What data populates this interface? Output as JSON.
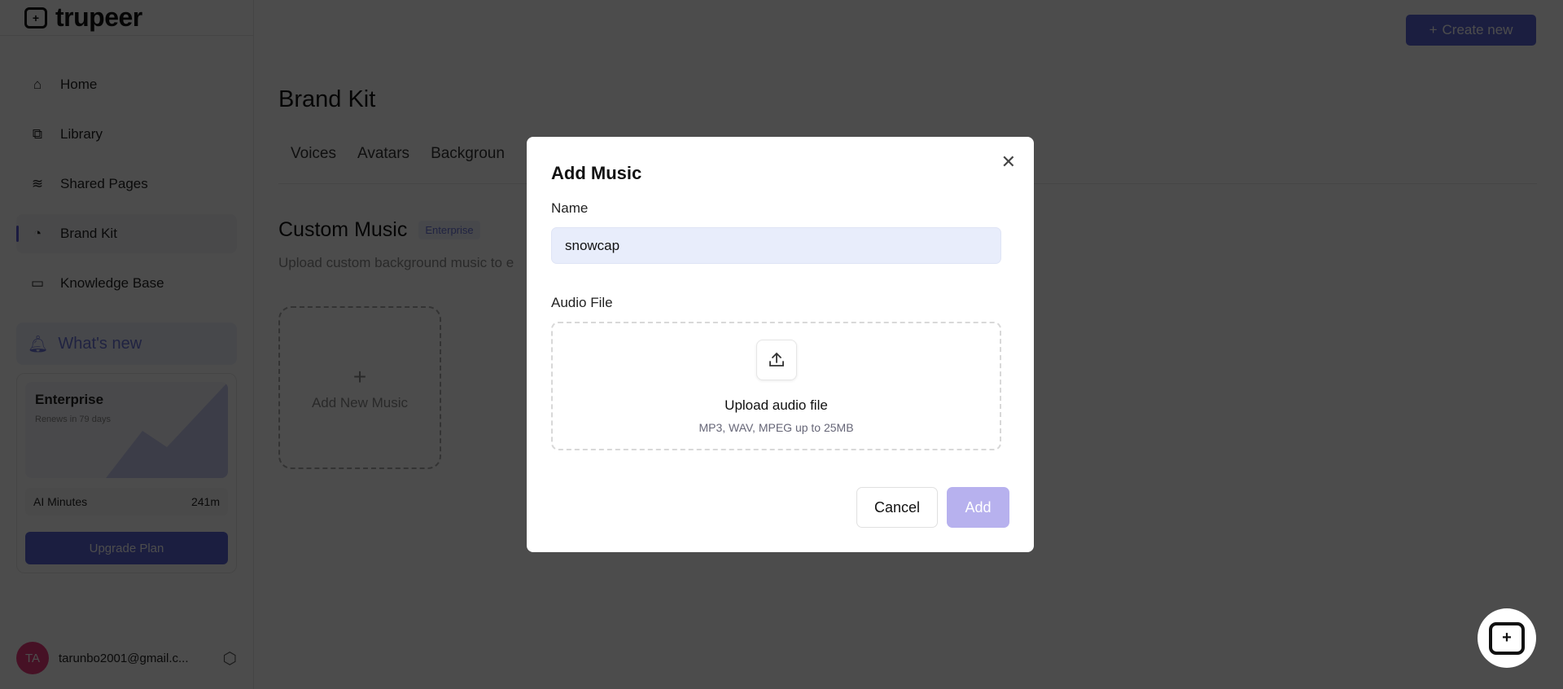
{
  "app": {
    "logo": "trupeer",
    "logo_mark": "+"
  },
  "sidebar": {
    "items": [
      {
        "label": "Home"
      },
      {
        "label": "Library"
      },
      {
        "label": "Shared Pages"
      },
      {
        "label": "Brand Kit"
      },
      {
        "label": "Knowledge Base"
      }
    ],
    "whats_new": "What's new",
    "plan": {
      "name": "Enterprise",
      "renews": "Renews in 79 days",
      "minutes_label": "AI Minutes",
      "minutes_value": "241m",
      "upgrade": "Upgrade Plan"
    },
    "user": {
      "initials": "TA",
      "email": "tarunbo2001@gmail.c..."
    }
  },
  "header": {
    "create": "Create new"
  },
  "page": {
    "title": "Brand Kit",
    "tabs": [
      "Voices",
      "Avatars",
      "Backgroun"
    ],
    "section_title": "Custom Music",
    "section_badge": "Enterprise",
    "section_desc": "Upload custom background music to e",
    "add_card": "Add New Music"
  },
  "modal": {
    "title": "Add Music",
    "name_label": "Name",
    "name_value": "snowcap",
    "audio_label": "Audio File",
    "upload_title": "Upload audio file",
    "upload_hint": "MP3, WAV, MPEG up to 25MB",
    "cancel": "Cancel",
    "add": "Add"
  }
}
